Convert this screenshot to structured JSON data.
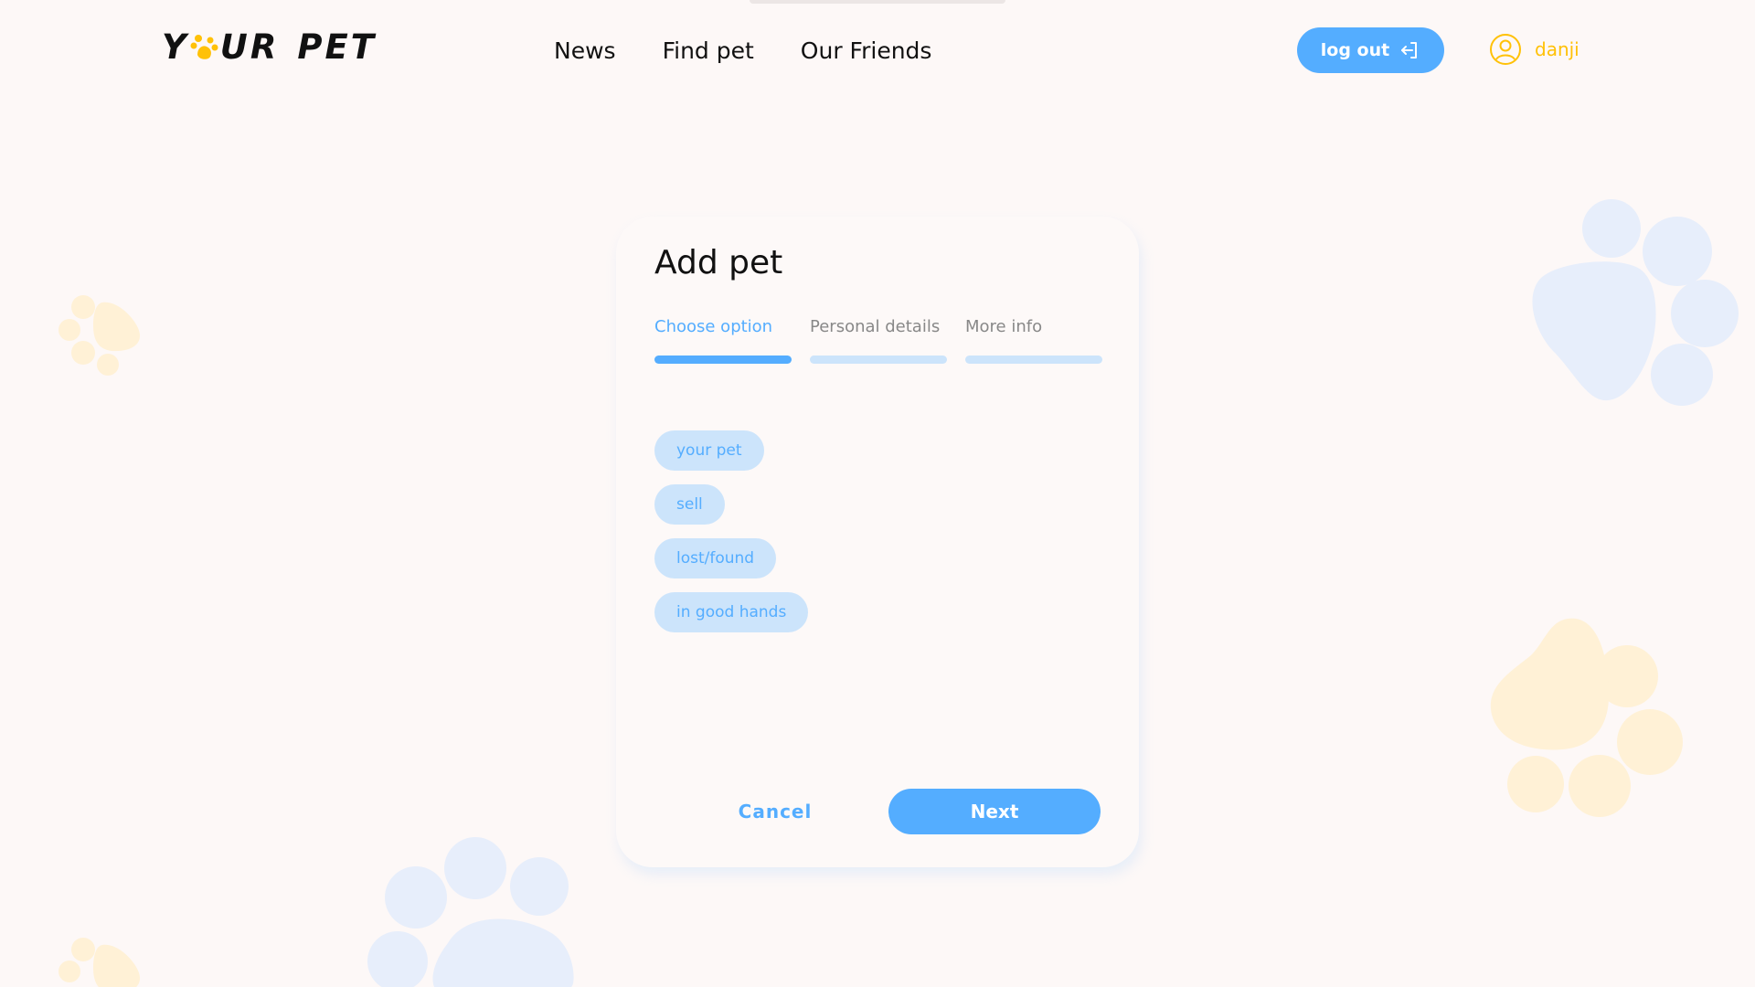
{
  "header": {
    "logo": {
      "part1": "Y",
      "part2": "UR",
      "part3": "PET"
    },
    "nav": [
      {
        "label": "News"
      },
      {
        "label": "Find pet"
      },
      {
        "label": "Our Friends"
      }
    ],
    "logout_label": "log out",
    "user_name": "danji"
  },
  "modal": {
    "title": "Add pet",
    "steps": [
      {
        "label": "Choose option",
        "active": true
      },
      {
        "label": "Personal details",
        "active": false
      },
      {
        "label": "More info",
        "active": false
      }
    ],
    "options": [
      {
        "label": "your pet"
      },
      {
        "label": "sell"
      },
      {
        "label": "lost/found"
      },
      {
        "label": "in good hands"
      }
    ],
    "cancel_label": "Cancel",
    "next_label": "Next"
  },
  "colors": {
    "accent": "#54ADFF",
    "accent_light": "#CCE4FB",
    "yellow": "#FFC107",
    "background": "#FDF8F7"
  },
  "icons": [
    "paw-logo-icon",
    "logout-icon",
    "user-icon",
    "paw-decoration-icon"
  ]
}
